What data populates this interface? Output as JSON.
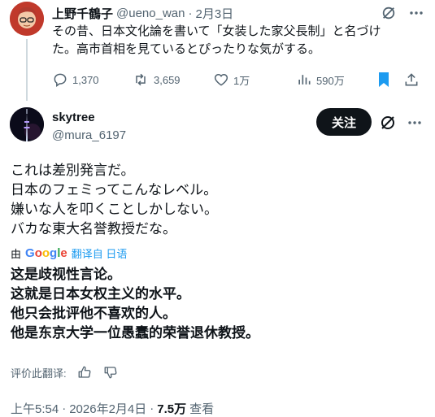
{
  "tweet1": {
    "name": "上野千鶴子",
    "handle": "@ueno_wan",
    "sep": "·",
    "date": "2月3日",
    "text_line1": "その昔、日本文化論を書いて「女装した家父長制」と名づけ",
    "text_line2": "た。高市首相を見ているとぴったりな気がする。",
    "actions": {
      "replies": "1,370",
      "retweets": "3,659",
      "likes": "1万",
      "views": "590万"
    }
  },
  "tweet2": {
    "name": "skytree",
    "handle": "@mura_6197",
    "follow_label": "关注",
    "text_lines": [
      "これは差別発言だ。",
      "日本のフェミってこんなレベル。",
      "嫌いな人を叩くことしかしない。",
      "バカな東大名誉教授だな。"
    ],
    "translation": {
      "by": "由",
      "google_letters": [
        "G",
        "o",
        "o",
        "g",
        "l",
        "e"
      ],
      "translated_from": "翻译自 日语",
      "lines": [
        "这是歧视性言论。",
        "这就是日本女权主义的水平。",
        "他只会批评他不喜欢的人。",
        "他是东京大学一位愚蠢的荣誉退休教授。"
      ],
      "rate_label": "评价此翻译:"
    },
    "meta": {
      "time": "上午5:54",
      "sep1": "·",
      "date": "2026年2月4日",
      "sep2": "·",
      "views_count": "7.5万",
      "views_label": "查看"
    }
  },
  "colors": {
    "accent": "#1d9bf0",
    "text": "#0f1419",
    "muted": "#536471",
    "google_blue": "#4285F4",
    "google_red": "#EA4335",
    "google_yellow": "#FBBC05",
    "google_green": "#34A853"
  }
}
